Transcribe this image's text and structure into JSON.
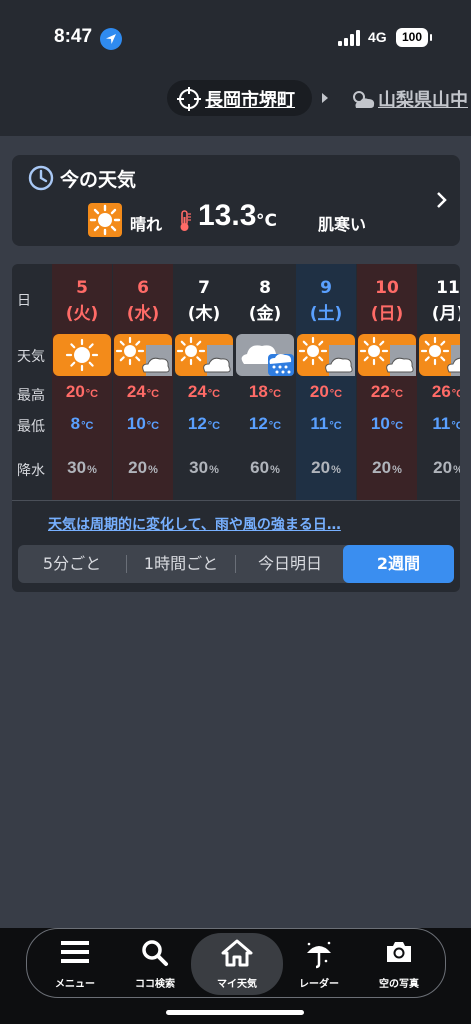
{
  "status": {
    "time": "8:47",
    "network": "4G",
    "battery": "100"
  },
  "header": {
    "location": "長岡市堺町",
    "location2": "山梨県山中"
  },
  "now": {
    "title": "今の天気",
    "condition": "晴れ",
    "temp": "13.3",
    "unit": "°C",
    "feel": "肌寒い"
  },
  "forecast": {
    "row_labels": {
      "day": "日",
      "weather": "天気",
      "high": "最高",
      "low": "最低",
      "precip": "降水"
    },
    "temp_unit": "°C",
    "pct_unit": "%",
    "days": [
      {
        "num": "5",
        "wd": "(火)",
        "hi": "20",
        "lo": "8",
        "pr": "30",
        "type": "sun"
      },
      {
        "num": "6",
        "wd": "(水)",
        "hi": "24",
        "lo": "10",
        "pr": "20",
        "type": "sun-cloud"
      },
      {
        "num": "7",
        "wd": "(木)",
        "hi": "24",
        "lo": "12",
        "pr": "30",
        "type": "sun-cloud"
      },
      {
        "num": "8",
        "wd": "(金)",
        "hi": "18",
        "lo": "12",
        "pr": "60",
        "type": "cloud-rain"
      },
      {
        "num": "9",
        "wd": "(土)",
        "hi": "20",
        "lo": "11",
        "pr": "20",
        "type": "sun-cloud"
      },
      {
        "num": "10",
        "wd": "(日)",
        "hi": "22",
        "lo": "10",
        "pr": "20",
        "type": "sun-cloud"
      },
      {
        "num": "11",
        "wd": "(月)",
        "hi": "26",
        "lo": "11",
        "pr": "20",
        "type": "sun-cloud"
      }
    ],
    "link": "天気は周期的に変化して、雨や風の強まる日…",
    "tabs": [
      "5分ごと",
      "1時間ごと",
      "今日明日",
      "2週間"
    ]
  },
  "nav": [
    "メニュー",
    "ココ検索",
    "マイ天気",
    "レーダー",
    "空の写真"
  ],
  "colors": {
    "orange": "#f38b1a",
    "red": "#ff6b67",
    "blue": "#5aa0ff",
    "active": "#3a8ef0"
  }
}
